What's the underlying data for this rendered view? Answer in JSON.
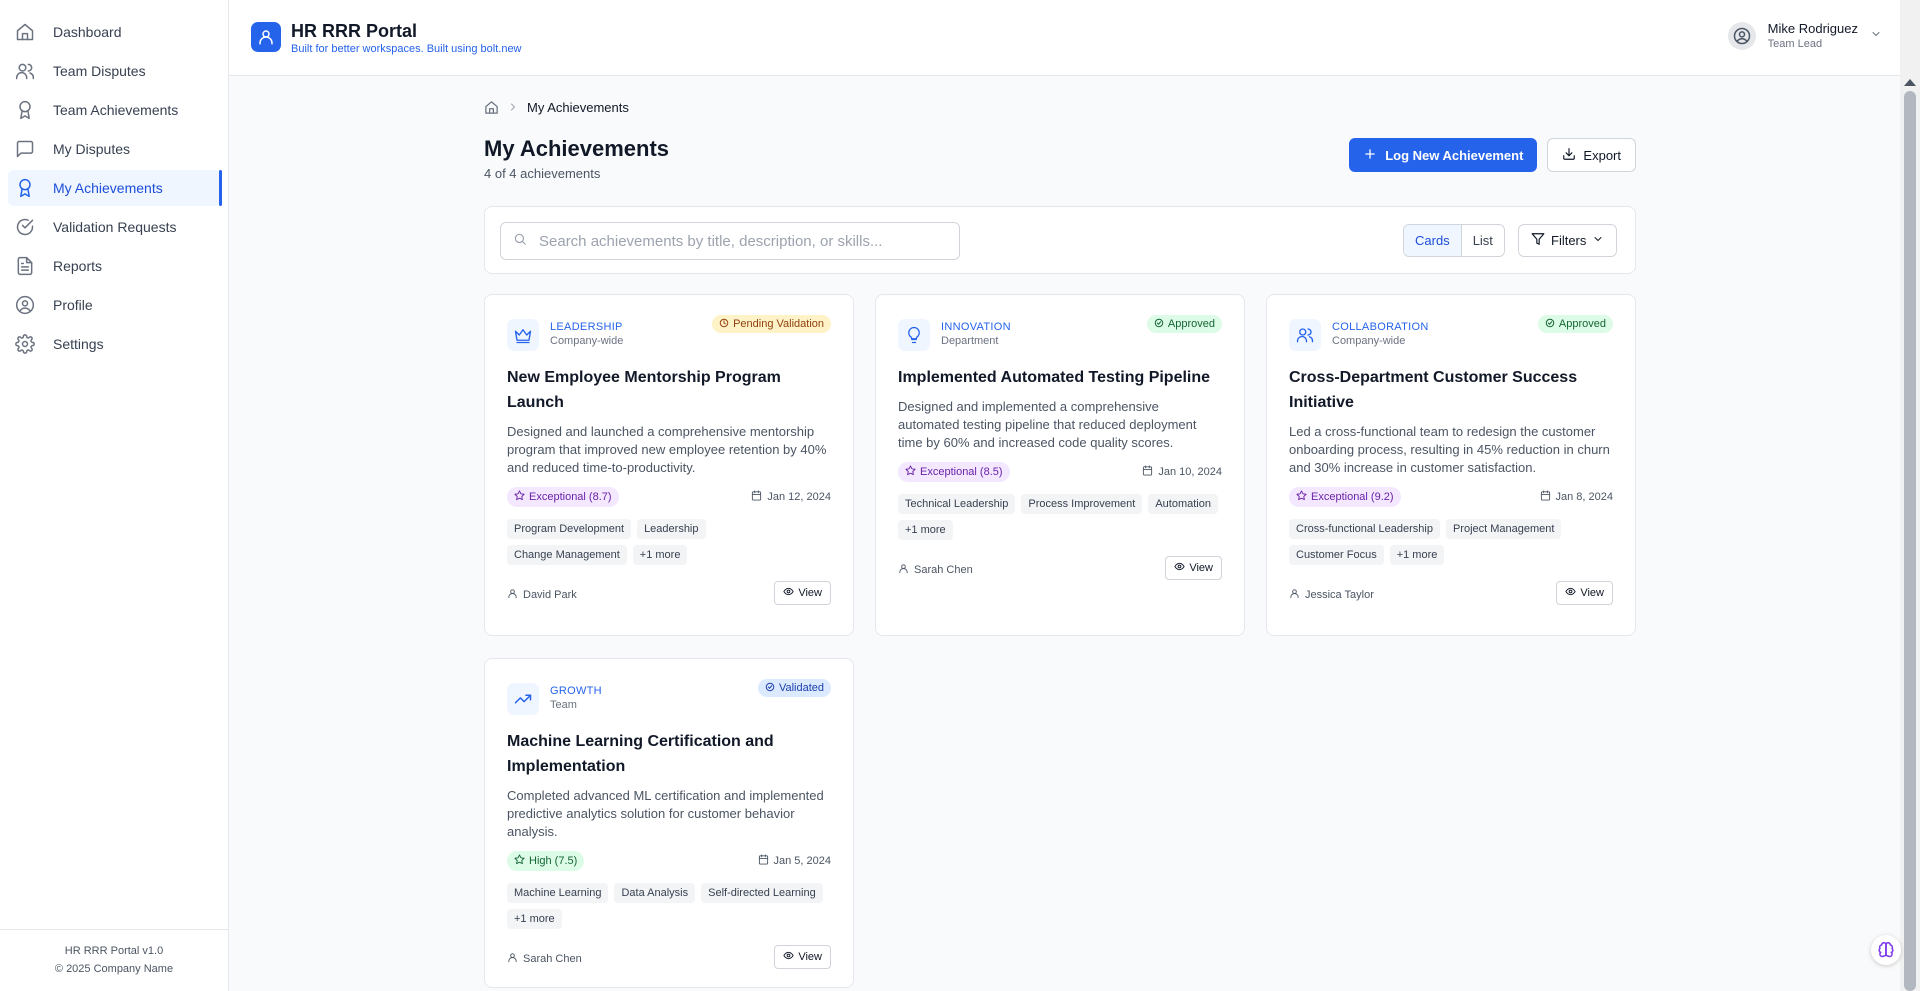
{
  "sidebar": {
    "items": [
      {
        "label": "Dashboard",
        "icon": "home-icon"
      },
      {
        "label": "Team Disputes",
        "icon": "users-icon"
      },
      {
        "label": "Team Achievements",
        "icon": "award-icon"
      },
      {
        "label": "My Disputes",
        "icon": "message-square-icon"
      },
      {
        "label": "My Achievements",
        "icon": "award-icon",
        "active": true
      },
      {
        "label": "Validation Requests",
        "icon": "check-circle-icon"
      },
      {
        "label": "Reports",
        "icon": "file-text-icon"
      },
      {
        "label": "Profile",
        "icon": "user-circle-icon"
      },
      {
        "label": "Settings",
        "icon": "gear-icon"
      }
    ],
    "footer_version": "HR RRR Portal v1.0",
    "footer_copyright": "© 2025 Company Name"
  },
  "header": {
    "title": "HR RRR Portal",
    "subtitle": "Built for better workspaces. Built using bolt.new",
    "user_name": "Mike Rodriguez",
    "user_role": "Team Lead"
  },
  "breadcrumb": {
    "current": "My Achievements"
  },
  "page": {
    "title": "My Achievements",
    "count": "4 of 4 achievements",
    "log_button": "Log New Achievement",
    "export_button": "Export"
  },
  "toolbar": {
    "search_placeholder": "Search achievements by title, description, or skills...",
    "view_cards": "Cards",
    "view_list": "List",
    "filters": "Filters"
  },
  "cards": [
    {
      "category": "LEADERSHIP",
      "scope": "Company-wide",
      "icon": "crown-icon",
      "status": "Pending Validation",
      "status_type": "pending",
      "title": "New Employee Mentorship Program Launch",
      "description": "Designed and launched a comprehensive mentorship program that improved new employee retention by 40% and reduced time-to-productivity.",
      "rating": "Exceptional (8.7)",
      "rating_type": "exc",
      "date": "Jan 12, 2024",
      "tags": [
        "Program Development",
        "Leadership",
        "Change Management",
        "+1 more"
      ],
      "owner": "David Park",
      "view": "View"
    },
    {
      "category": "INNOVATION",
      "scope": "Department",
      "icon": "lightbulb-icon",
      "status": "Approved",
      "status_type": "approved",
      "title": "Implemented Automated Testing Pipeline",
      "description": "Designed and implemented a comprehensive automated testing pipeline that reduced deployment time by 60% and increased code quality scores.",
      "rating": "Exceptional (8.5)",
      "rating_type": "exc",
      "date": "Jan 10, 2024",
      "tags": [
        "Technical Leadership",
        "Process Improvement",
        "Automation",
        "+1 more"
      ],
      "owner": "Sarah Chen",
      "view": "View"
    },
    {
      "category": "COLLABORATION",
      "scope": "Company-wide",
      "icon": "users-icon",
      "status": "Approved",
      "status_type": "approved",
      "title": "Cross-Department Customer Success Initiative",
      "description": "Led a cross-functional team to redesign the customer onboarding process, resulting in 45% reduction in churn and 30% increase in customer satisfaction.",
      "rating": "Exceptional (9.2)",
      "rating_type": "exc",
      "date": "Jan 8, 2024",
      "tags": [
        "Cross-functional Leadership",
        "Project Management",
        "Customer Focus",
        "+1 more"
      ],
      "owner": "Jessica Taylor",
      "view": "View"
    },
    {
      "category": "GROWTH",
      "scope": "Team",
      "icon": "trending-up-icon",
      "status": "Validated",
      "status_type": "validated",
      "title": "Machine Learning Certification and Implementation",
      "description": "Completed advanced ML certification and implemented predictive analytics solution for customer behavior analysis.",
      "rating": "High (7.5)",
      "rating_type": "high",
      "date": "Jan 5, 2024",
      "tags": [
        "Machine Learning",
        "Data Analysis",
        "Self-directed Learning",
        "+1 more"
      ],
      "owner": "Sarah Chen",
      "view": "View"
    }
  ]
}
